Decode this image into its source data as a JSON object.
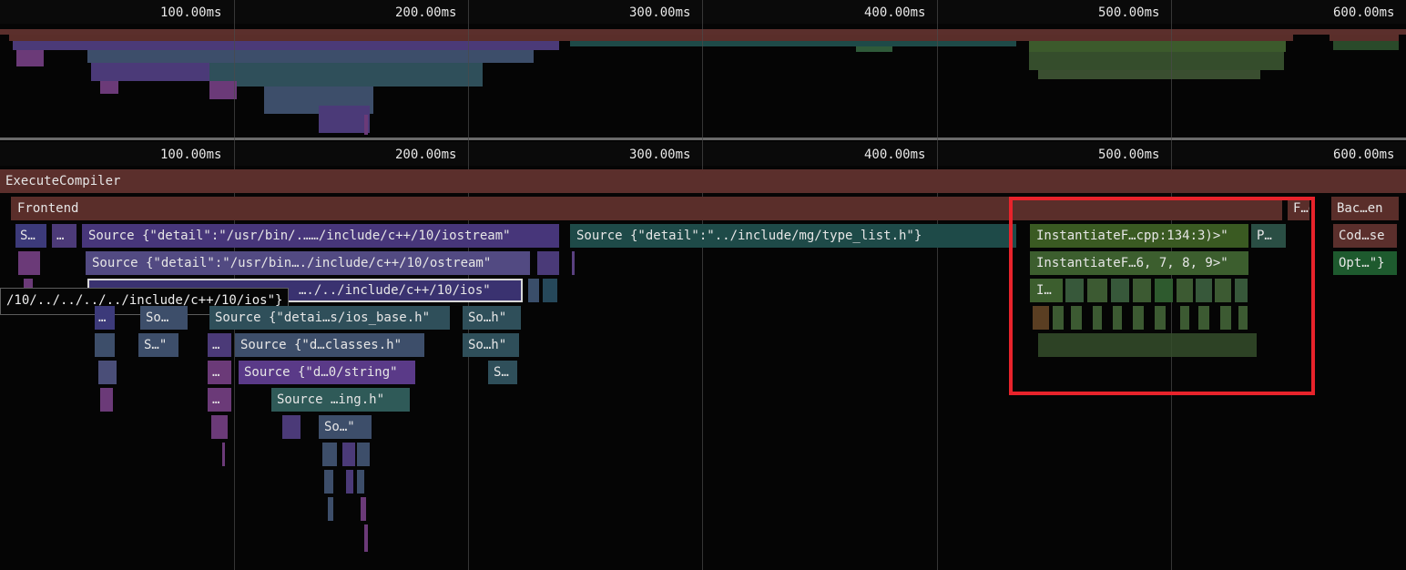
{
  "ruler_ticks": [
    "100.00ms",
    "200.00ms",
    "300.00ms",
    "400.00ms",
    "500.00ms",
    "600.00ms"
  ],
  "frames": {
    "execute_compiler": "ExecuteCompiler",
    "frontend": "Frontend",
    "frontend_end": "F…d",
    "backend": "Bac…en",
    "row3": {
      "s1": "S…",
      "dots1": "…",
      "iostream": "Source {\"detail\":\"/usr/bin/.……/include/c++/10/iostream\"",
      "type_list": "Source {\"detail\":\"../include/mg/type_list.h\"}",
      "instantiate1": "InstantiateF…cpp:134:3)>\"",
      "p": "P…",
      "codegen": "Cod…se"
    },
    "row4": {
      "ostream": "Source {\"detail\":\"/usr/bin…./include/c++/10/ostream\"",
      "instantiate2": "InstantiateF…6, 7, 8, 9>\"",
      "opt": "Opt…\"}"
    },
    "row5": {
      "ios": "…./../include/c++/10/ios\"",
      "i": "I…"
    },
    "row6": {
      "dots": "…",
      "so1": "So…",
      "ios_base": "Source {\"detai…s/ios_base.h\"",
      "soh": "So…h\""
    },
    "row7": {
      "s": "S…\"",
      "dots": "…",
      "classes": "Source {\"d…classes.h\"",
      "soh": "So…h\""
    },
    "row8": {
      "dots": "…",
      "string": "Source {\"d…0/string\"",
      "s": "S…"
    },
    "row9": {
      "dots": "…",
      "ing": "Source …ing.h\""
    },
    "row10": {
      "so": "So…\""
    }
  },
  "tooltip": "/10/../../../../include/c++/10/ios\"}",
  "colors": {
    "execute_compiler": "#5b2f2c",
    "frontend": "#5a2e2a",
    "purple": "#4b3a78",
    "teal": "#1e4a48",
    "green": "#3c5a2c",
    "highlight": "#e8232b"
  }
}
